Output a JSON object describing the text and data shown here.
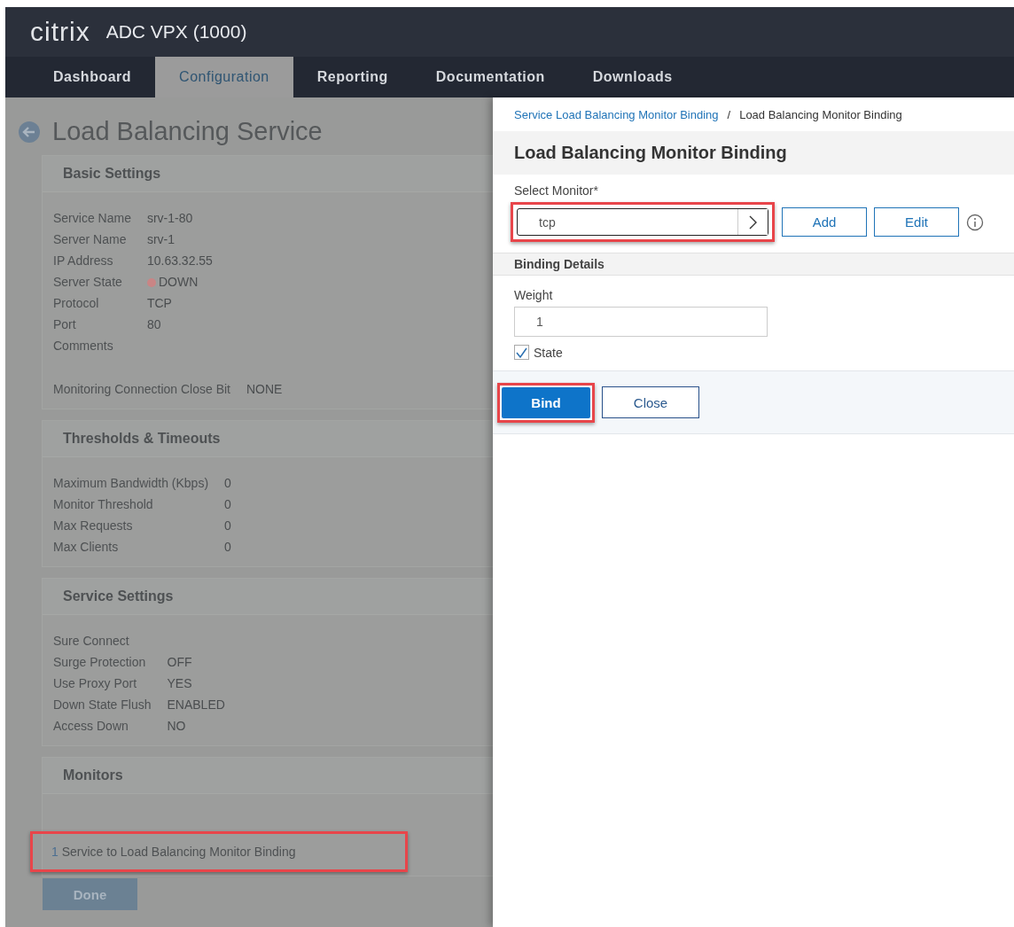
{
  "header": {
    "logo": "citrix",
    "product": "ADC VPX (1000)"
  },
  "nav": [
    {
      "label": "Dashboard",
      "selected": false
    },
    {
      "label": "Configuration",
      "selected": true
    },
    {
      "label": "Reporting",
      "selected": false
    },
    {
      "label": "Documentation",
      "selected": false
    },
    {
      "label": "Downloads",
      "selected": false
    }
  ],
  "background_page": {
    "title": "Load Balancing Service",
    "sections": [
      {
        "title": "Basic Settings",
        "groups": [
          [
            {
              "label": "Service Name",
              "value": "srv-1-80"
            },
            {
              "label": "Server Name",
              "value": "srv-1"
            },
            {
              "label": "IP Address",
              "value": "10.63.32.55"
            },
            {
              "label": "Server State",
              "value": "DOWN",
              "color": "#c98585"
            },
            {
              "label": "Protocol",
              "value": "TCP"
            },
            {
              "label": "Port",
              "value": "80"
            },
            {
              "label": "Comments"
            }
          ],
          [
            {
              "label": "Monitoring Connection Close Bit",
              "value": "NONE"
            }
          ]
        ]
      },
      {
        "title": "Thresholds & Timeouts",
        "groups": [
          [
            {
              "label": "Maximum Bandwidth (Kbps)",
              "value": "0"
            },
            {
              "label": "Monitor Threshold",
              "value": "0"
            },
            {
              "label": "Max Requests",
              "value": "0"
            },
            {
              "label": "Max Clients",
              "value": "0"
            }
          ]
        ]
      },
      {
        "title": "Service Settings",
        "groups": [
          [
            {
              "label": "Sure Connect"
            },
            {
              "label": "Surge Protection",
              "value": "OFF"
            },
            {
              "label": "Use Proxy Port",
              "value": "YES"
            },
            {
              "label": "Down State Flush",
              "value": "ENABLED"
            },
            {
              "label": "Access Down",
              "value": "NO"
            }
          ]
        ]
      }
    ],
    "monitors": {
      "title": "Monitors",
      "count": "1",
      "link": "Service to Load Balancing Monitor Binding",
      "highlighted": true
    },
    "done_button": "Done"
  },
  "panel": {
    "breadcrumb": {
      "link": "Service Load Balancing Monitor Binding",
      "separator": "/",
      "current": "Load Balancing Monitor Binding"
    },
    "title": "Load Balancing Monitor Binding",
    "select_monitor": {
      "label": "Select Monitor*",
      "value": "tcp",
      "highlighted": true
    },
    "monitor_buttons": [
      "Add",
      "Edit"
    ],
    "binding_details": "Binding Details",
    "weight": {
      "label": "Weight",
      "value": "1"
    },
    "state": {
      "label": "State",
      "checked": true
    },
    "bind_button": {
      "label": "Bind",
      "highlighted": true
    },
    "close_button": "Close"
  }
}
